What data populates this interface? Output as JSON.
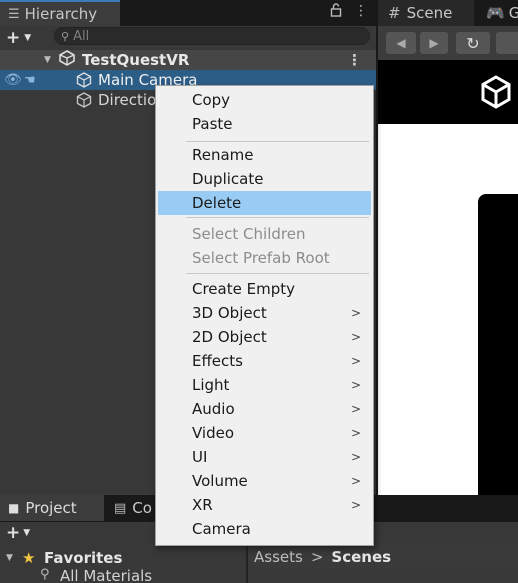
{
  "hierarchy": {
    "tab_title": "Hierarchy",
    "tab_icon": "list-icon",
    "search_placeholder": "All",
    "scene_name": "TestQuestVR",
    "objects": [
      "Main Camera",
      "Directio"
    ]
  },
  "scene_view": {
    "tab_title": "Scene",
    "game_tab_title": "Ga"
  },
  "context_menu": {
    "items": [
      {
        "label": "Copy",
        "enabled": true
      },
      {
        "label": "Paste",
        "enabled": true
      },
      {
        "label": "Rename",
        "enabled": true
      },
      {
        "label": "Duplicate",
        "enabled": true
      },
      {
        "label": "Delete",
        "enabled": true,
        "highlighted": true
      },
      {
        "label": "Select Children",
        "enabled": false
      },
      {
        "label": "Select Prefab Root",
        "enabled": false
      },
      {
        "label": "Create Empty",
        "enabled": true
      },
      {
        "label": "3D Object",
        "enabled": true,
        "submenu": true
      },
      {
        "label": "2D Object",
        "enabled": true,
        "submenu": true
      },
      {
        "label": "Effects",
        "enabled": true,
        "submenu": true
      },
      {
        "label": "Light",
        "enabled": true,
        "submenu": true
      },
      {
        "label": "Audio",
        "enabled": true,
        "submenu": true
      },
      {
        "label": "Video",
        "enabled": true,
        "submenu": true
      },
      {
        "label": "UI",
        "enabled": true,
        "submenu": true
      },
      {
        "label": "Volume",
        "enabled": true,
        "submenu": true
      },
      {
        "label": "XR",
        "enabled": true,
        "submenu": true
      },
      {
        "label": "Camera",
        "enabled": true
      }
    ],
    "submenu_arrow": ">"
  },
  "project": {
    "tab_title": "Project",
    "console_tab_title": "Co",
    "favorites_label": "Favorites",
    "all_materials_label": "All Materials",
    "breadcrumb": {
      "root": "Assets",
      "separator": ">",
      "current": "Scenes"
    }
  },
  "colors": {
    "selection_blue": "#2c5d87",
    "menu_highlight": "#99ccf5",
    "favorites_star": "#f4c542"
  }
}
